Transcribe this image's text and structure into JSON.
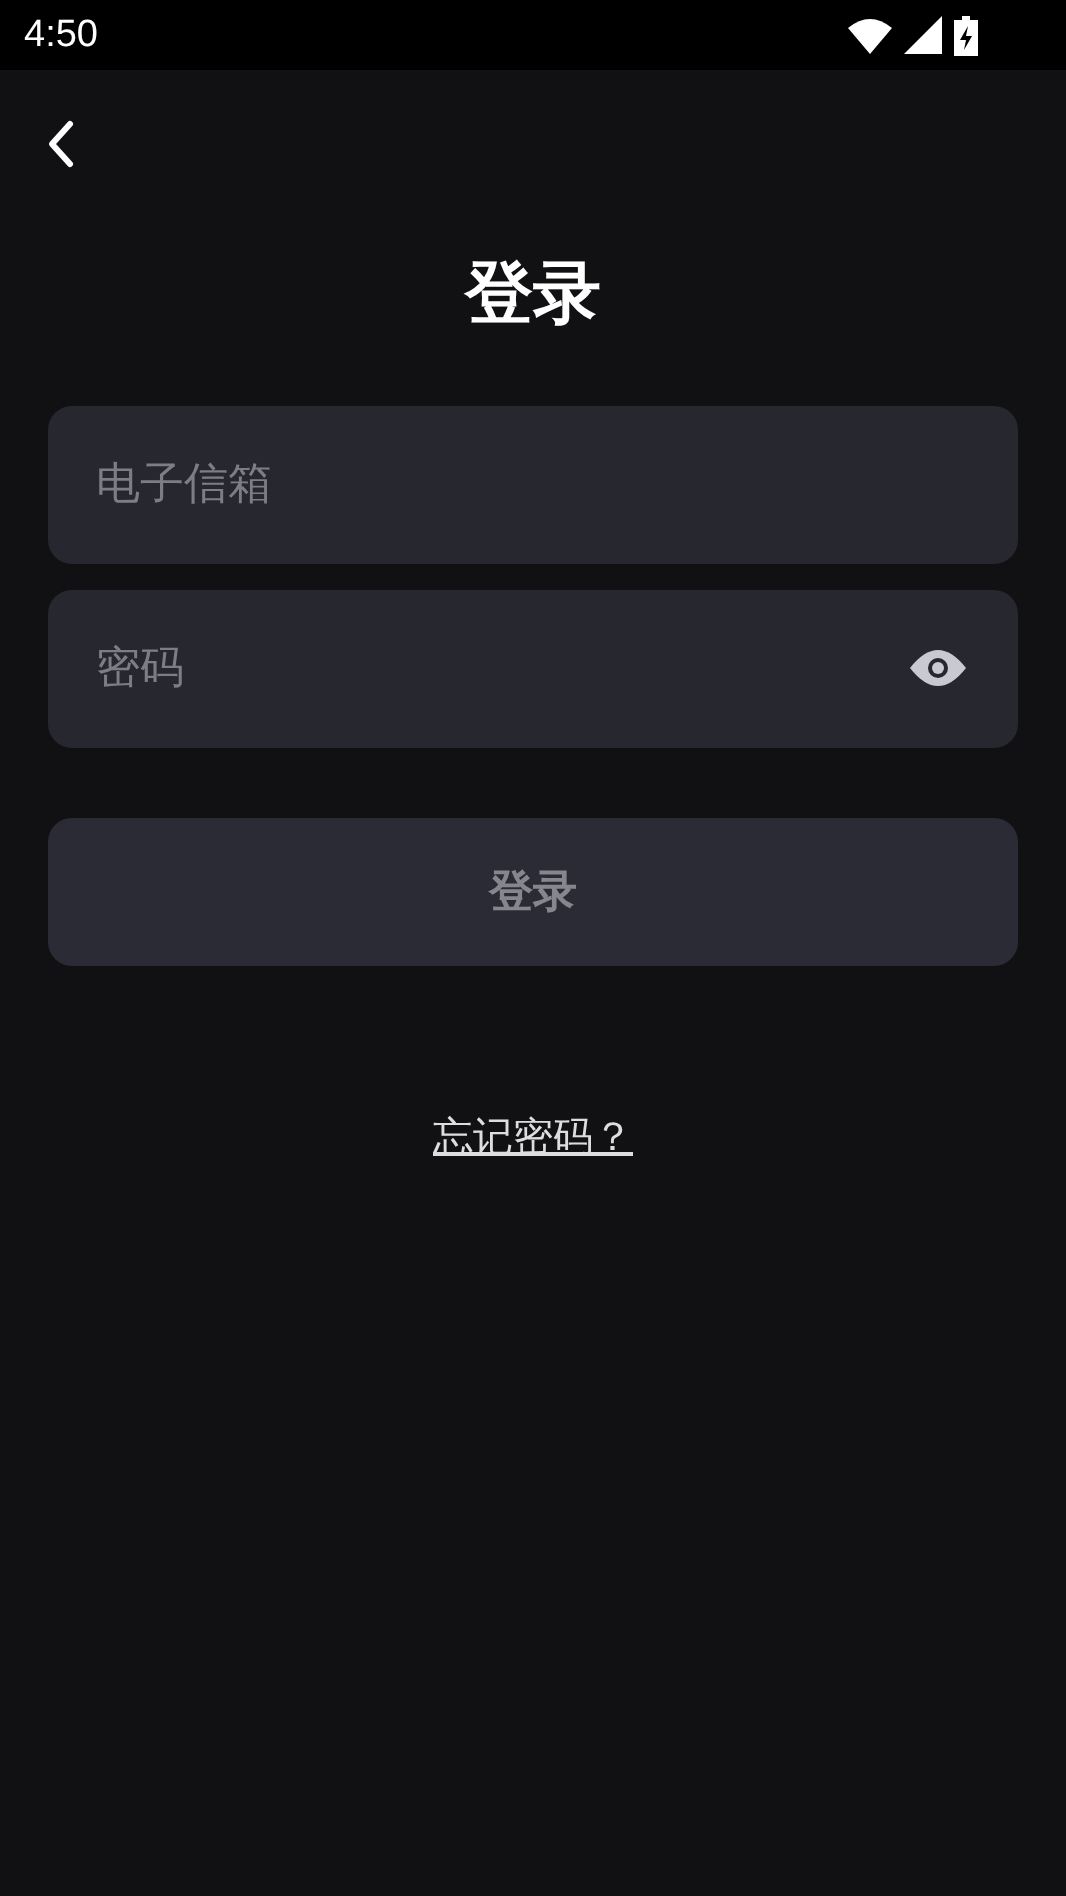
{
  "status_bar": {
    "time": "4:50"
  },
  "title": "登录",
  "fields": [
    {
      "kind": "email",
      "placeholder": "电子信箱"
    },
    {
      "kind": "password",
      "placeholder": "密码"
    }
  ],
  "login_button": {
    "label": "登录",
    "disabled": true
  },
  "forgot_link": "忘记密码？"
}
